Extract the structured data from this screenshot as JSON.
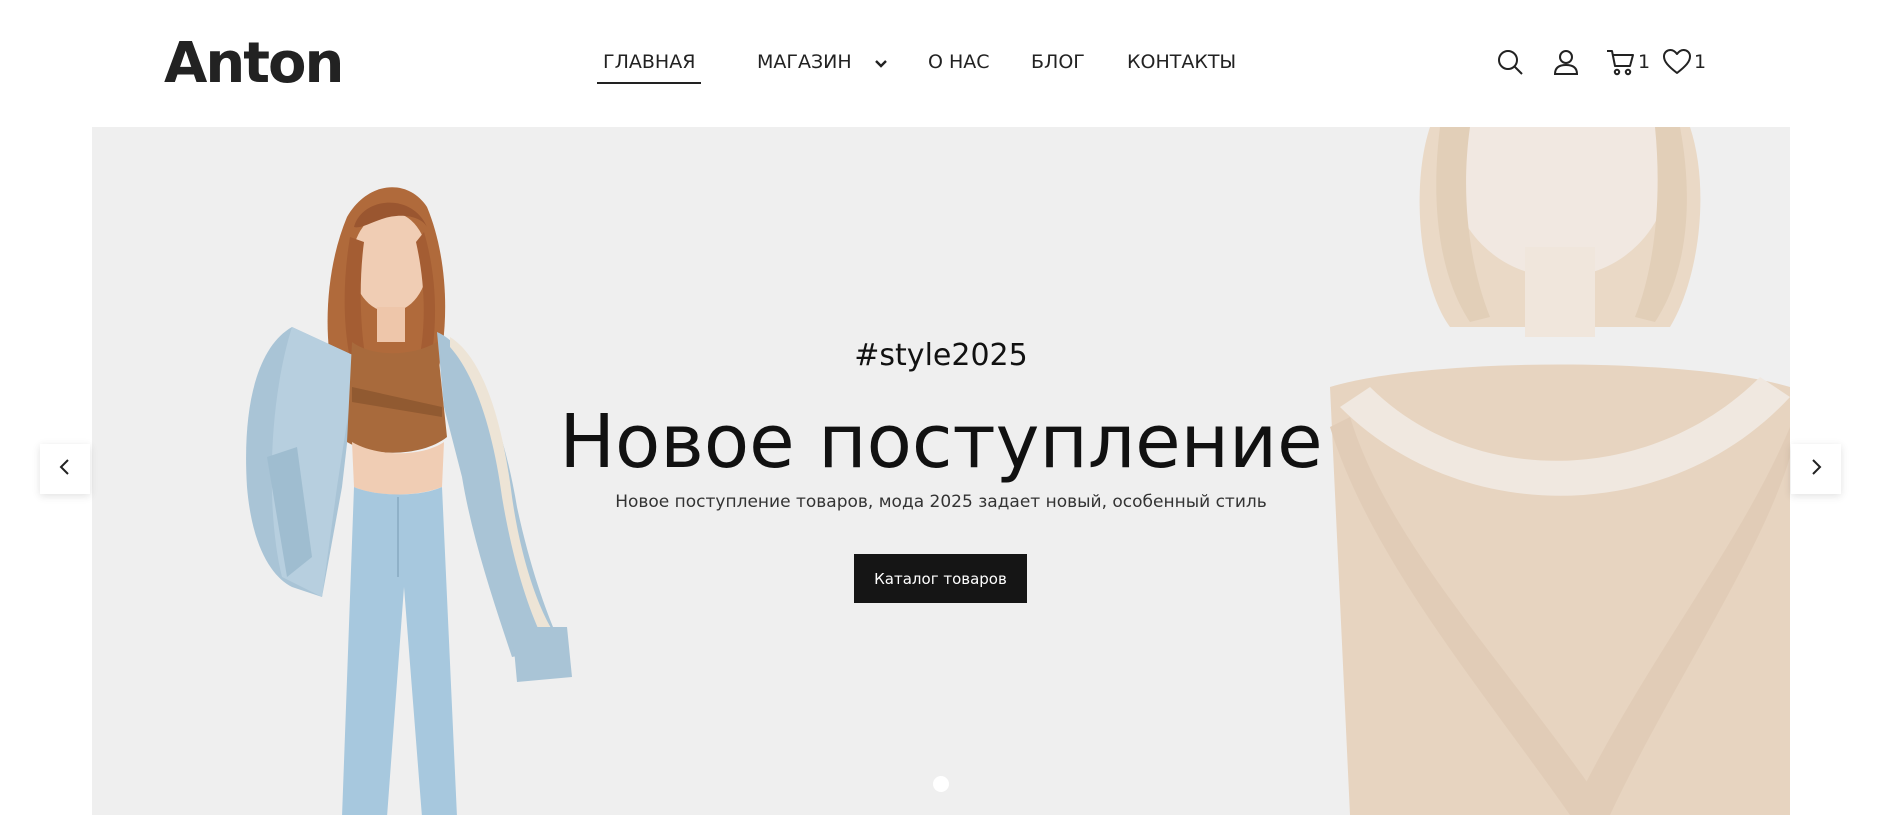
{
  "brand": {
    "logo_text": "Anton"
  },
  "nav": {
    "home": "ГЛАВНАЯ",
    "shop": "МАГАЗИН",
    "about": "О НАС",
    "blog": "БЛОГ",
    "contacts": "КОНТАКТЫ"
  },
  "header_icons": {
    "cart_count": "1",
    "wishlist_count": "1"
  },
  "hero": {
    "tag": "#style2025",
    "title": "Новое поступление",
    "subtitle": "Новое поступление товаров, мода 2025 задает новый, особенный стиль",
    "button_label": "Каталог товаров"
  },
  "colors": {
    "accent": "#151515",
    "hero_bg": "#efefef"
  }
}
